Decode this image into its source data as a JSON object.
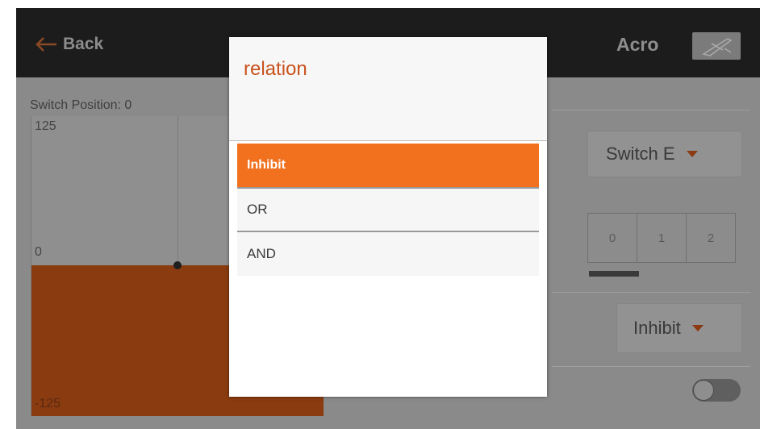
{
  "header": {
    "back_label": "Back",
    "model_name": "Acro"
  },
  "background": {
    "switch_position_label": "Switch Position: 0",
    "graph": {
      "y_top": "125",
      "y_mid": "0",
      "y_bottom": "-125"
    },
    "switch_select_value": "Switch E",
    "positions": [
      "0",
      "1",
      "2"
    ],
    "relation_value": "Inhibit"
  },
  "modal": {
    "title": "relation",
    "options": [
      {
        "label": "Inhibit",
        "selected": true
      },
      {
        "label": "OR",
        "selected": false
      },
      {
        "label": "AND",
        "selected": false
      }
    ]
  },
  "colors": {
    "accent": "#f2711f",
    "title_text": "#c9521d",
    "graph_fill_dim": "#8a3b10"
  }
}
